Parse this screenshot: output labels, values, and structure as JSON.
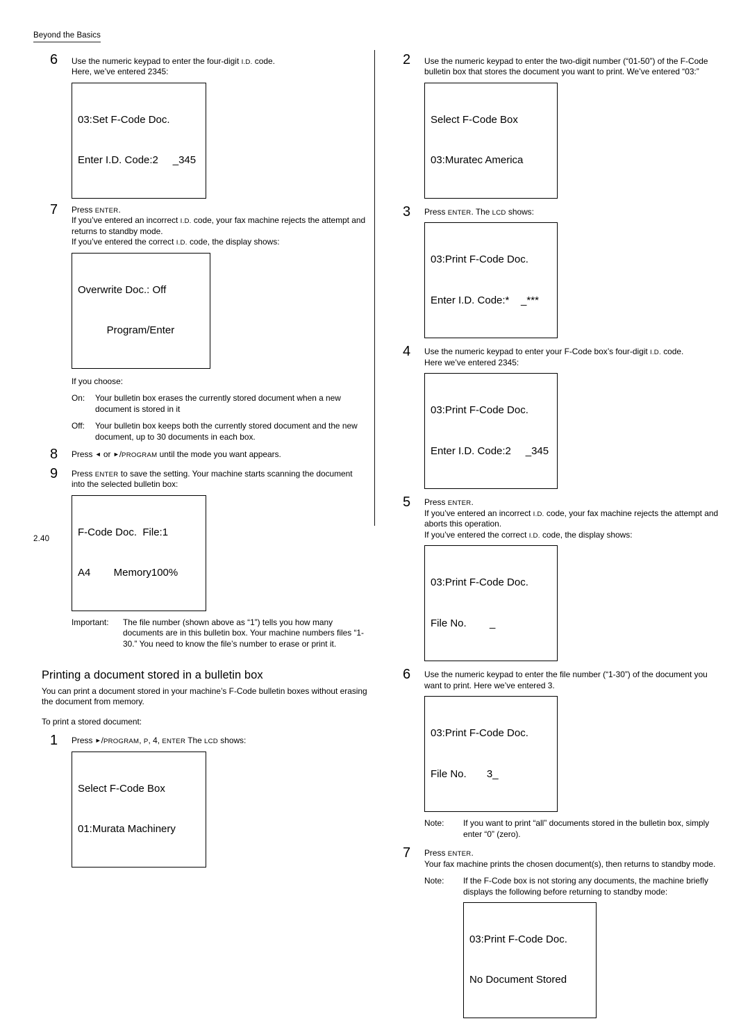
{
  "page": {
    "running_head": "Beyond the Basics",
    "folio": "2.40"
  },
  "left_column": {
    "step6": {
      "number": "6",
      "line1_a": "Use the numeric keypad to enter the four-digit ",
      "line1_sc": "I.D.",
      "line1_b": " code.",
      "line2": "Here, we’ve entered 2345:",
      "lcd": {
        "line1": "03:Set F-Code Doc.",
        "line2": "Enter I.D. Code:2     _345"
      }
    },
    "step7": {
      "number": "7",
      "press_a": "Press ",
      "press_key": "Enter",
      "press_b": ".",
      "line2_a": "If you’ve entered an incorrect ",
      "line2_sc": "I.D.",
      "line2_b": " code, your fax machine rejects the attempt and returns to standby mode.",
      "line3_a": "If you’ve entered the correct ",
      "line3_sc": "I.D.",
      "line3_b": " code, the display shows:",
      "lcd": {
        "line1": "Overwrite Doc.: Off",
        "line2": "          Program/Enter"
      },
      "choose_label": "If you choose:",
      "on": {
        "tag": "On:",
        "body": "Your bulletin box erases the currently stored document when a new document is stored in it"
      },
      "off": {
        "tag": "Off:",
        "body": "Your bulletin box keeps both the currently stored document and the new document, up to 30 documents in each box."
      }
    },
    "step8": {
      "number": "8",
      "text_a": "Press ",
      "arrow_left": "◄",
      "text_b": " or ",
      "arrow_right": "►",
      "slash": "/",
      "program_key": "Program",
      "text_c": " until the mode you want appears."
    },
    "step9": {
      "number": "9",
      "text_a": "Press ",
      "press_key": "Enter",
      "text_b": " to save the setting. Your machine starts scanning the document into the selected bulletin box:",
      "lcd": {
        "line1": "F-Code Doc.  File:1",
        "line2": "A4        Memory100%"
      },
      "important": {
        "tag": "Important:",
        "body": "The file number (shown above as “1”) tells you how many documents are in this bulletin box. Your machine numbers files “1-30.” You need to know the file’s number to erase or print it."
      }
    },
    "section": {
      "heading": "Printing a document stored in a bulletin box",
      "intro": "You can print a document stored in your machine’s F-Code bulletin boxes without erasing the document from memory.",
      "lead_in": "To print a stored document:"
    },
    "step1": {
      "number": "1",
      "text_a": "Press ",
      "arrow_right": "►",
      "slash": "/",
      "program_key": "Program",
      "text_b": ", ",
      "p_key": "P",
      "text_c": ", 4, ",
      "enter_key": "Enter",
      "text_d": " The ",
      "lcd_key": "LCD",
      "text_e": " shows:",
      "lcd": {
        "line1": "Select F-Code Box",
        "line2": "01:Murata Machinery"
      }
    }
  },
  "right_column": {
    "step2": {
      "number": "2",
      "text": "Use the numeric keypad to enter the two-digit number (“01-50”) of the F-Code bulletin box that stores the document you want to print. We’ve entered “03:”",
      "lcd": {
        "line1": "Select F-Code Box",
        "line2": "03:Muratec America"
      }
    },
    "step3": {
      "number": "3",
      "text_a": "Press ",
      "enter_key": "Enter",
      "text_b": ". The ",
      "lcd_key": "LCD",
      "text_c": " shows:",
      "lcd": {
        "line1": "03:Print F-Code Doc.",
        "line2": "Enter I.D. Code:*    _***"
      }
    },
    "step4": {
      "number": "4",
      "line1_a": "Use the numeric keypad to enter your F-Code box’s four-digit ",
      "line1_sc": "I.D.",
      "line1_b": " code.",
      "line2": "Here we’ve entered 2345:",
      "lcd": {
        "line1": "03:Print F-Code Doc.",
        "line2": "Enter I.D. Code:2     _345"
      }
    },
    "step5": {
      "number": "5",
      "press_a": "Press ",
      "enter_key": "Enter",
      "press_b": ".",
      "line2_a": "If you’ve entered an incorrect ",
      "line2_sc": "I.D.",
      "line2_b": " code, your fax machine rejects the attempt and aborts this operation.",
      "line3_a": "If you’ve entered the correct ",
      "line3_sc": "I.D.",
      "line3_b": " code, the display shows:",
      "lcd": {
        "line1": "03:Print F-Code Doc.",
        "line2": "File No.        _"
      }
    },
    "step6": {
      "number": "6",
      "text": "Use the numeric keypad to enter the file number (“1-30”) of the document you want to print. Here we’ve entered 3.",
      "lcd": {
        "line1": "03:Print F-Code Doc.",
        "line2": "File No.       3_"
      },
      "note": {
        "tag": "Note:",
        "body": "If you want to print “all” documents stored in the bulletin box, simply enter “0” (zero)."
      }
    },
    "step7": {
      "number": "7",
      "press_a": "Press ",
      "enter_key": "Enter",
      "press_b": ".",
      "line2": "Your fax machine prints the chosen document(s), then returns to standby mode.",
      "note": {
        "tag": "Note:",
        "body": "If the F-Code box is not storing any documents, the machine briefly displays the following before returning to standby mode:"
      },
      "lcd": {
        "line1": "03:Print F-Code Doc.",
        "line2": "No Document Stored"
      }
    }
  }
}
